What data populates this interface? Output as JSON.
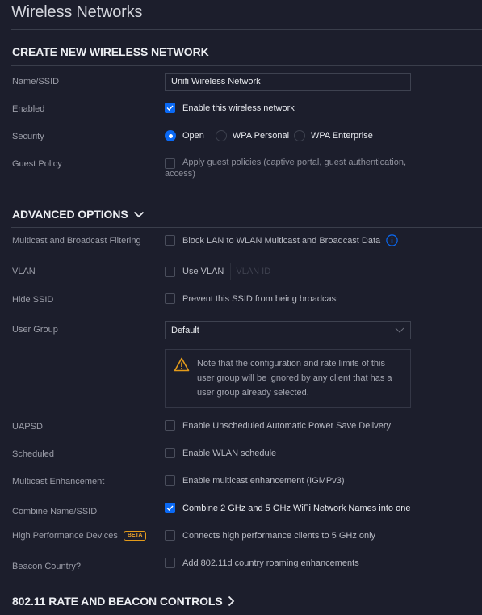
{
  "page": {
    "title": "Wireless Networks"
  },
  "colors": {
    "accent": "#0a69f4",
    "warning": "#e49b1a",
    "background": "#1c1e2c"
  },
  "create": {
    "section_title": "CREATE NEW WIRELESS NETWORK",
    "name_label": "Name/SSID",
    "name_value": "Unifi Wireless Network",
    "enabled_label": "Enabled",
    "enabled_text": "Enable this wireless network",
    "enabled_checked": true,
    "security_label": "Security",
    "security_options": [
      {
        "label": "Open",
        "selected": true
      },
      {
        "label": "WPA Personal",
        "selected": false
      },
      {
        "label": "WPA Enterprise",
        "selected": false
      }
    ],
    "guest_label": "Guest Policy",
    "guest_text_line1": "Apply guest policies (captive portal, guest authentication,",
    "guest_text_line2": "access)",
    "guest_checked": false
  },
  "advanced": {
    "section_title": "ADVANCED OPTIONS",
    "icon": "chevron-down-icon",
    "multicast_filter_label": "Multicast and Broadcast Filtering",
    "multicast_filter_text": "Block LAN to WLAN Multicast and Broadcast Data",
    "vlan_label": "VLAN",
    "vlan_text": "Use VLAN",
    "vlan_placeholder": "VLAN ID",
    "hide_ssid_label": "Hide SSID",
    "hide_ssid_text": "Prevent this SSID from being broadcast",
    "user_group_label": "User Group",
    "user_group_value": "Default",
    "user_group_note": "Note that the configuration and rate limits of this user group will be ignored by any client that has a user group already selected.",
    "uapsd_label": "UAPSD",
    "uapsd_text": "Enable Unscheduled Automatic Power Save Delivery",
    "scheduled_label": "Scheduled",
    "scheduled_text": "Enable WLAN schedule",
    "mcast_enh_label": "Multicast Enhancement",
    "mcast_enh_text": "Enable multicast enhancement (IGMPv3)",
    "combine_label": "Combine Name/SSID",
    "combine_text": "Combine 2 GHz and 5 GHz WiFi Network Names into one",
    "combine_checked": true,
    "hpd_label": "High Performance Devices",
    "hpd_badge": "BETA",
    "hpd_text": "Connects high performance clients to 5 GHz only",
    "beacon_label": "Beacon Country?",
    "beacon_text": "Add 802.11d country roaming enhancements"
  },
  "rate": {
    "section_title": "802.11 RATE AND BEACON CONTROLS",
    "icon": "chevron-right-icon"
  }
}
